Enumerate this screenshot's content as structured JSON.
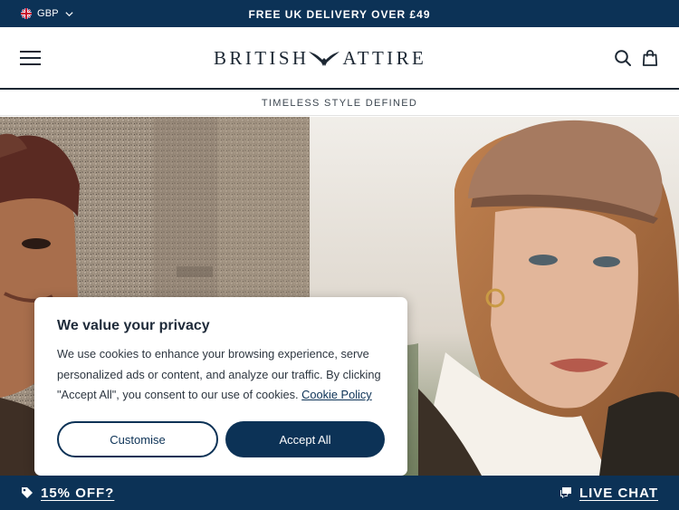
{
  "top_bar": {
    "currency": "GBP",
    "announcement": "FREE UK DELIVERY OVER £49"
  },
  "header": {
    "logo_left": "BRITISH",
    "logo_right": "ATTIRE",
    "menu_icon": "hamburger-menu-icon",
    "search_icon": "search-icon",
    "cart_icon": "shopping-bag-icon"
  },
  "tagline": "TIMELESS STYLE DEFINED",
  "cookie_banner": {
    "title": "We value your privacy",
    "body": "We use cookies to enhance your browsing experience, serve personalized ads or content, and analyze our traffic. By clicking \"Accept All\", you consent to our use of cookies.",
    "policy_link": "Cookie Policy",
    "customise_label": "Customise",
    "accept_label": "Accept All"
  },
  "bottom_bar": {
    "promo_label": "15% OFF?",
    "chat_label": "LIVE CHAT"
  },
  "colors": {
    "brand_navy": "#0c3256",
    "text_dark": "#1f2b3a"
  }
}
